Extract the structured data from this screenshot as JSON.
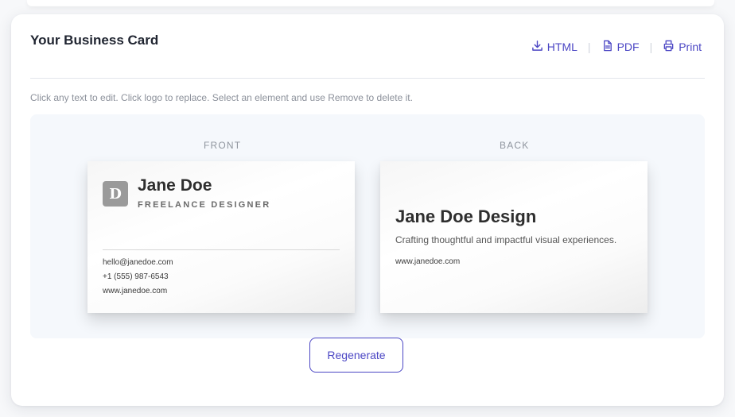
{
  "header": {
    "title": "Your Business Card",
    "actions": [
      {
        "label": "HTML",
        "icon": "download-icon"
      },
      {
        "label": "PDF",
        "icon": "file-icon"
      },
      {
        "label": "Print",
        "icon": "printer-icon"
      }
    ],
    "separator": "|"
  },
  "hint": "Click any text to edit. Click logo to replace. Select an element and use Remove to delete it.",
  "front": {
    "side_label": "FRONT",
    "logo_letter": "D",
    "name": "Jane Doe",
    "role": "FREELANCE DESIGNER",
    "email": "hello@janedoe.com",
    "phone": "+1 (555) 987-6543",
    "website": "www.janedoe.com"
  },
  "back": {
    "side_label": "BACK",
    "title": "Jane Doe Design",
    "tagline": "Crafting thoughtful and impactful visual experiences.",
    "website": "www.janedoe.com"
  },
  "regenerate_label": "Regenerate",
  "colors": {
    "accent": "#4b46c4",
    "logo_bg": "#9a9a9a",
    "stage_bg": "#f5f8fc"
  }
}
